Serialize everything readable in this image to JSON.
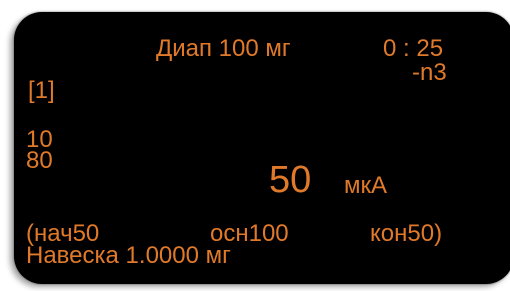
{
  "display": {
    "range_label": "Диап 100 мг",
    "time": "0 : 25",
    "channel": "[1]",
    "mode_suffix": "-n3",
    "level_top": "10",
    "level_bottom": "80",
    "current_value": "50",
    "current_unit": "мкА",
    "params": {
      "start": "(нач50",
      "main": "осн100",
      "end": "кон50)"
    },
    "sample_weight": "Навеска 1.0000 мг"
  },
  "colors": {
    "background": "#000000",
    "text": "#e07a2a"
  }
}
